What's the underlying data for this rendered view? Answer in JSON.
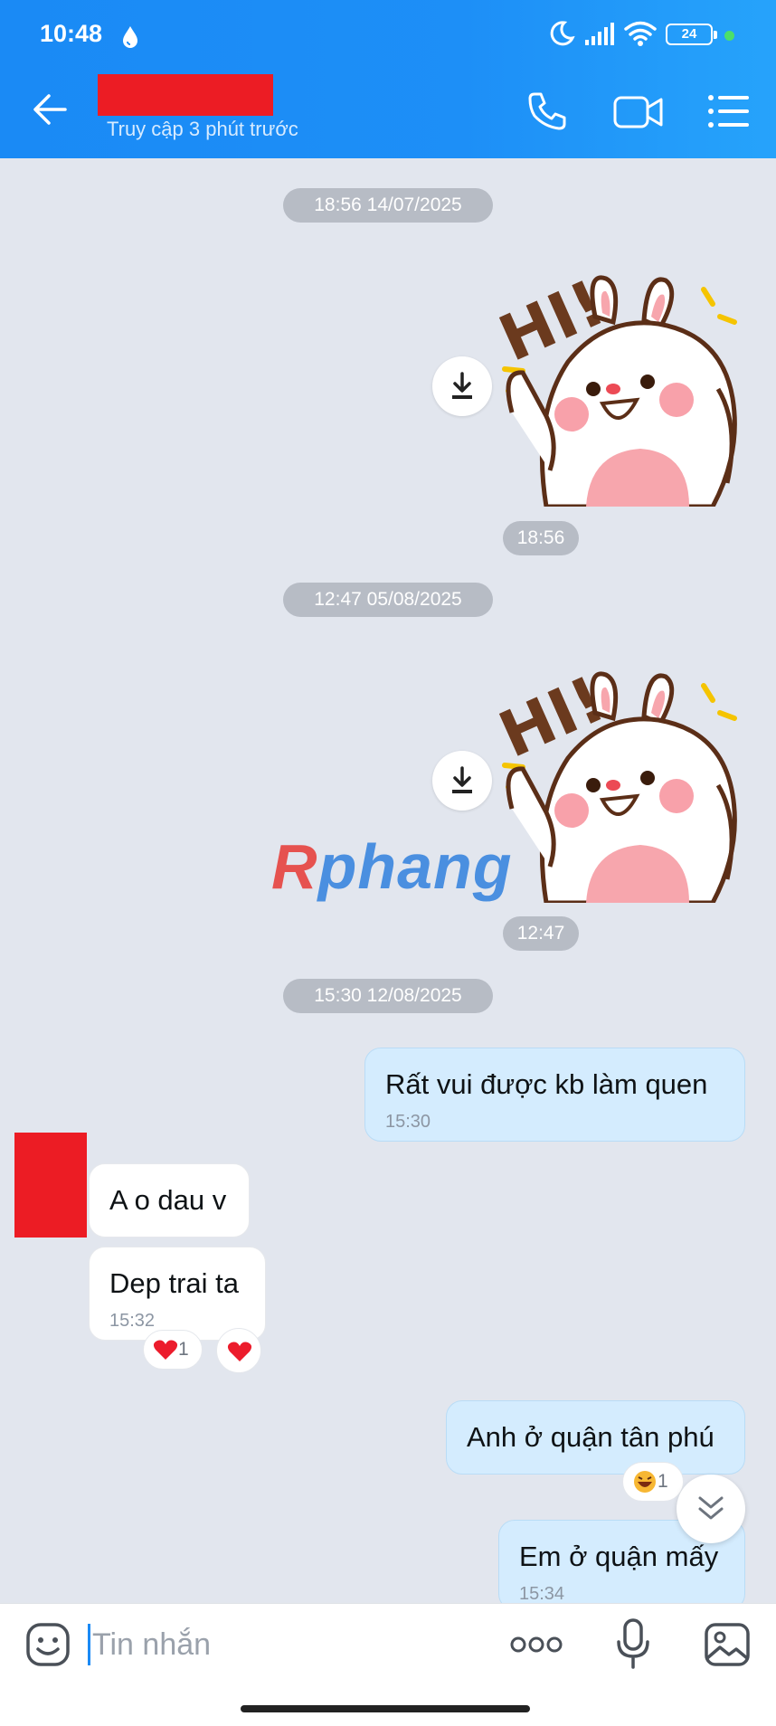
{
  "status_bar": {
    "time": "10:48",
    "battery": "24"
  },
  "header": {
    "last_seen": "Truy cập 3 phút trước"
  },
  "messages": {
    "date_1": "18:56 14/07/2025",
    "sticker_1_time": "18:56",
    "date_2": "12:47 05/08/2025",
    "sticker_2_time": "12:47",
    "date_3": "15:30 12/08/2025",
    "m1_text": "Rất vui được kb làm quen",
    "m1_time": "15:30",
    "m2_text": "A o dau v",
    "m3_text": "Dep trai ta",
    "m3_time": "15:32",
    "m3_reaction_count": "1",
    "m4_text": "Anh ở quận tân phú",
    "m4_reaction_count": "1",
    "m5_text": "Em ở quận mấy",
    "m5_time": "15:34"
  },
  "sticker_text": "HI!",
  "watermark": {
    "first": "R",
    "rest": "phang"
  },
  "input": {
    "placeholder": "Tin nhắn"
  },
  "colors": {
    "header": "#1a8af5",
    "my_bubble": "#d4ecfe",
    "their_bubble": "#ffffff",
    "background": "#e2e6ee"
  }
}
